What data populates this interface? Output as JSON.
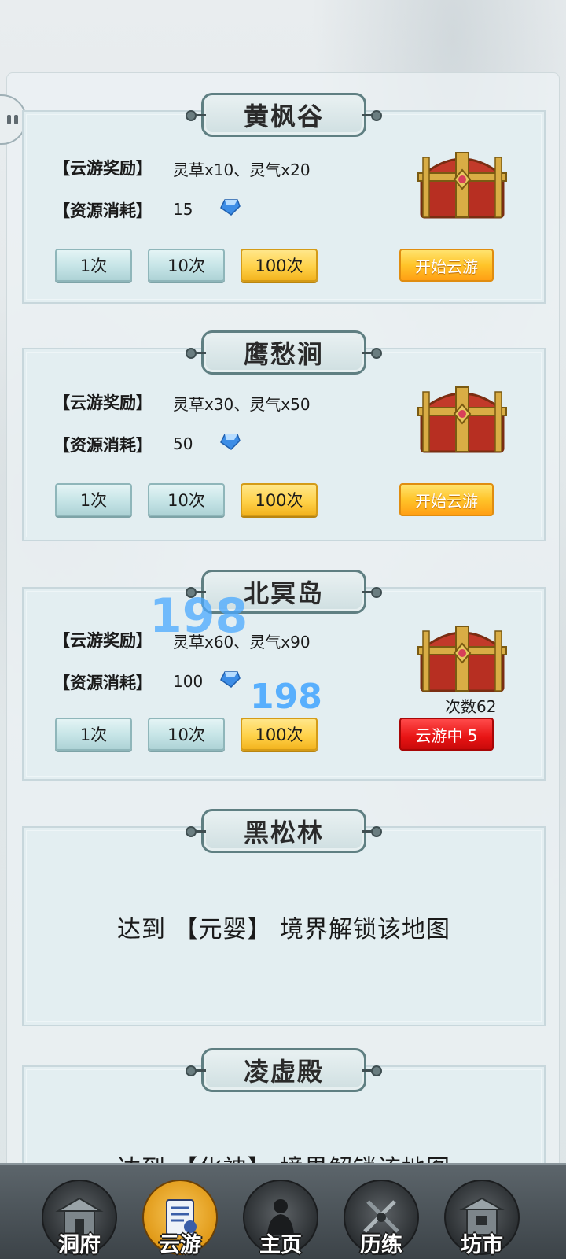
{
  "side_toggle": "pause-icon",
  "labels": {
    "reward": "【云游奖励】",
    "cost": "【资源消耗】"
  },
  "buttons": {
    "once": "1次",
    "ten": "10次",
    "hundred": "100次",
    "start": "开始云游"
  },
  "maps": [
    {
      "name": "黄枫谷",
      "reward": "灵草x10、灵气x20",
      "cost": "15",
      "cost_icon": "spirit-stone-icon",
      "chest_icon": "treasure-chest-icon",
      "status": "开始云游"
    },
    {
      "name": "鹰愁涧",
      "reward": "灵草x30、灵气x50",
      "cost": "50",
      "cost_icon": "spirit-stone-icon",
      "chest_icon": "treasure-chest-icon",
      "status": "开始云游"
    },
    {
      "name": "北冥岛",
      "reward": "灵草x60、灵气x90",
      "cost": "100",
      "cost_icon": "spirit-stone-icon",
      "chest_icon": "treasure-chest-icon",
      "counter": "次数62",
      "status": "云游中  5",
      "floating_numbers": [
        "198",
        "198"
      ]
    },
    {
      "name": "黑松林",
      "locked_text": "达到 【元婴】 境界解锁该地图"
    },
    {
      "name": "凌虚殿",
      "locked_text": "达到 【化神】 境界解锁该地图"
    }
  ],
  "nav": [
    {
      "label": "洞府",
      "icon": "cave-dwelling-icon",
      "active": false
    },
    {
      "label": "云游",
      "icon": "wander-scroll-icon",
      "active": true
    },
    {
      "label": "主页",
      "icon": "cultivator-silhouette-icon",
      "active": false
    },
    {
      "label": "历练",
      "icon": "training-swords-icon",
      "active": false
    },
    {
      "label": "坊市",
      "icon": "market-building-icon",
      "active": false
    }
  ],
  "colors": {
    "start_button": "#ffc429",
    "running_button": "#e81414",
    "selected_count_button": "#ffd24a",
    "count_button": "#c5e4e6",
    "floating_number": "#4aa9ff"
  }
}
